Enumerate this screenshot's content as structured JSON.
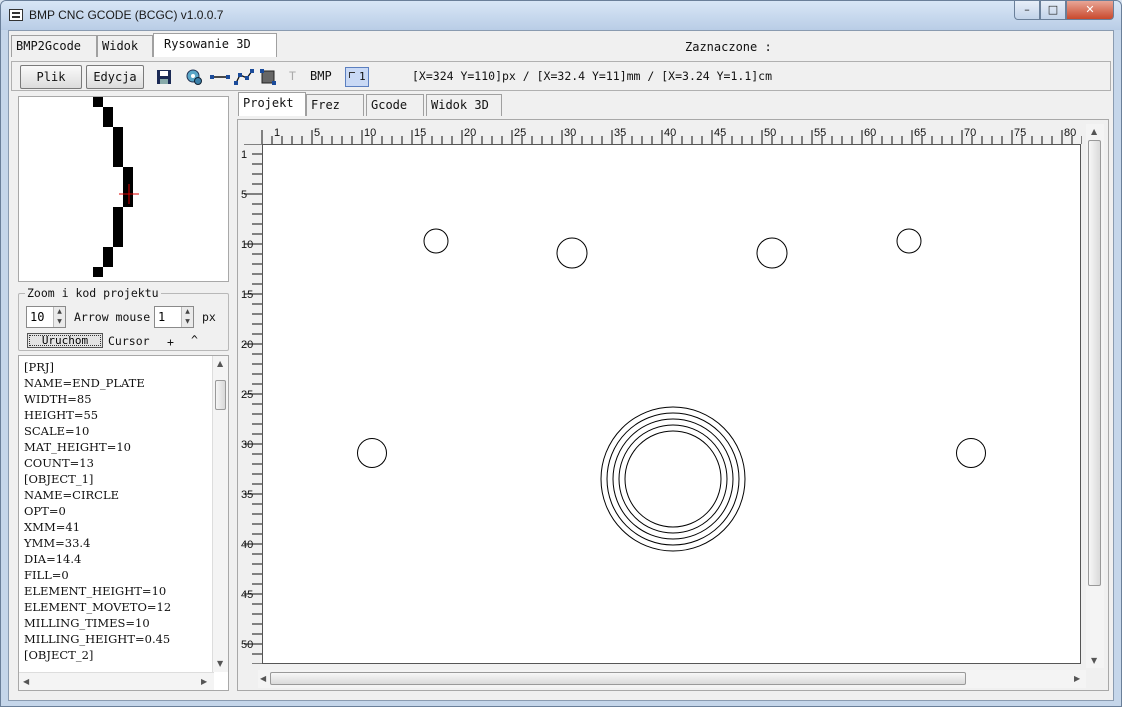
{
  "window": {
    "title": "BMP CNC GCODE (BCGC) v1.0.0.7",
    "min_glyph": "–",
    "max_glyph": "□",
    "close_glyph": "✕"
  },
  "main_tabs": [
    "BMP2Gcode",
    "Widok",
    "Rysowanie 3D"
  ],
  "active_main_tab": "Rysowanie 3D",
  "selection_label": "Zaznaczone :",
  "toolbar": {
    "plik_label": "Plik",
    "edycja_label": "Edycja",
    "icons": [
      "save-icon",
      "gear-circle-icon",
      "line-icon",
      "polyline-icon",
      "rectangle-icon",
      "text-icon"
    ],
    "text_tool_label": "T",
    "bmp_label": "BMP",
    "ruler_toggle_label": "1",
    "coords_text": "[X=324 Y=110]px / [X=32.4 Y=11]mm / [X=3.24 Y=1.1]cm"
  },
  "zoom_panel": {
    "legend": "Zoom i kod projektu",
    "zoom_value": "10",
    "arrow_mouse_label": "Arrow mouse",
    "arrow_step_value": "1",
    "px_label": "px",
    "run_button_label": "Uruchom",
    "cursor_label": "Cursor",
    "cursor_plus": "+",
    "cursor_caret": "^"
  },
  "project_code": [
    "[PRJ]",
    "NAME=END_PLATE",
    "WIDTH=85",
    "HEIGHT=55",
    "SCALE=10",
    "MAT_HEIGHT=10",
    "COUNT=13",
    "[OBJECT_1]",
    "NAME=CIRCLE",
    "OPT=0",
    "XMM=41",
    "YMM=33.4",
    "DIA=14.4",
    "FILL=0",
    "ELEMENT_HEIGHT=10",
    "ELEMENT_MOVETO=12",
    "MILLING_TIMES=10",
    "MILLING_HEIGHT=0.45",
    "[OBJECT_2]"
  ],
  "sub_tabs": [
    "Projekt",
    "Frez",
    "Gcode",
    "Widok 3D"
  ],
  "active_sub_tab": "Projekt",
  "drawing": {
    "ruler_top_labels": [
      "1",
      "5",
      "10",
      "15",
      "20",
      "25",
      "30",
      "35",
      "40",
      "45",
      "50",
      "55",
      "60",
      "65",
      "70",
      "75",
      "80"
    ],
    "ruler_left_labels": [
      "1",
      "5",
      "10",
      "15",
      "20",
      "25",
      "30",
      "35",
      "40",
      "45",
      "50"
    ],
    "circles_mm": [
      {
        "x": 17.3,
        "y": 9.6,
        "d": 2.4
      },
      {
        "x": 30.9,
        "y": 10.8,
        "d": 3.0
      },
      {
        "x": 50.9,
        "y": 10.8,
        "d": 3.0
      },
      {
        "x": 64.6,
        "y": 9.6,
        "d": 2.4
      },
      {
        "x": 10.9,
        "y": 30.8,
        "d": 2.9
      },
      {
        "x": 70.8,
        "y": 30.8,
        "d": 2.9
      },
      {
        "x": 41,
        "y": 33.4,
        "d": 14.4
      },
      {
        "x": 41,
        "y": 33.4,
        "d": 13.2
      },
      {
        "x": 41,
        "y": 33.4,
        "d": 12.0
      },
      {
        "x": 41,
        "y": 33.4,
        "d": 10.8
      },
      {
        "x": 41,
        "y": 33.4,
        "d": 9.6
      }
    ]
  }
}
